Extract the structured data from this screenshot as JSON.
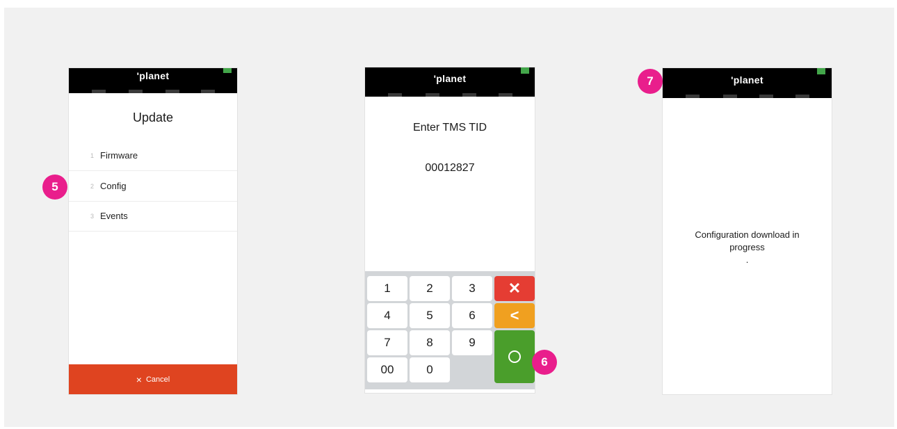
{
  "brand": {
    "logo": "'planet",
    "battery_color": "#43a64a"
  },
  "screen1": {
    "title": "Update",
    "menu": [
      {
        "num": "1",
        "label": "Firmware"
      },
      {
        "num": "2",
        "label": "Config"
      },
      {
        "num": "3",
        "label": "Events"
      }
    ],
    "cancel_icon": "×",
    "cancel_label": "Cancel"
  },
  "screen2": {
    "title": "Enter TMS TID",
    "value": "00012827",
    "keys": {
      "k1": "1",
      "k2": "2",
      "k3": "3",
      "k4": "4",
      "k5": "5",
      "k6": "6",
      "k7": "7",
      "k8": "8",
      "k9": "9",
      "k00": "00",
      "k0": "0",
      "clear": "✕",
      "back": "<"
    }
  },
  "screen3": {
    "message": "Configuration download in progress",
    "dots": "."
  },
  "badges": {
    "b5": "5",
    "b6": "6",
    "b7": "7"
  },
  "colors": {
    "badge": "#e91e8c",
    "cancel": "#df4420",
    "clear": "#e53d33",
    "back": "#f0a020",
    "ok": "#4a9e2b"
  }
}
